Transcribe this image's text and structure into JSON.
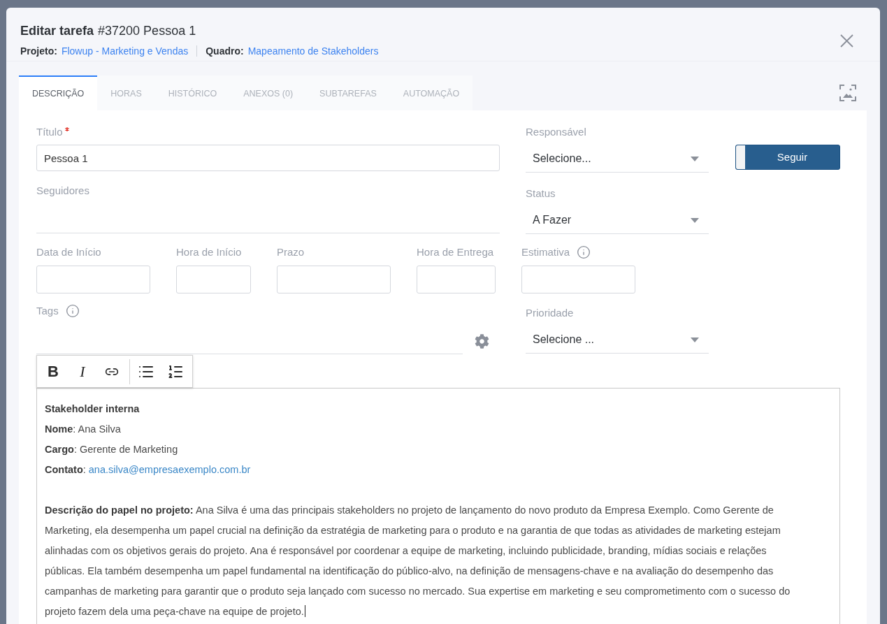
{
  "dialog": {
    "title": "Editar tarefa",
    "task": "#37200 Pessoa 1",
    "project": {
      "label": "Projeto:",
      "link": "Flowup - Marketing e Vendas"
    },
    "board": {
      "label": "Quadro:",
      "link": "Mapeamento de Stakeholders"
    }
  },
  "tabs": [
    {
      "label": "DESCRIÇÃO",
      "selected": true
    },
    {
      "label": "HORAS",
      "selected": false
    },
    {
      "label": "HISTÓRICO",
      "selected": false
    },
    {
      "label": "ANEXOS (0)",
      "selected": false
    },
    {
      "label": "SUBTAREFAS",
      "selected": false
    },
    {
      "label": "AUTOMAÇÃO",
      "selected": false
    }
  ],
  "form": {
    "title_field": {
      "label": "Título",
      "required": true,
      "value": "Pessoa 1"
    },
    "followers": {
      "label": "Seguidores"
    },
    "assignee": {
      "label": "Responsável",
      "value": "Selecione..."
    },
    "follow_button": {
      "label": "Seguir"
    },
    "status": {
      "label": "Status",
      "value": "A Fazer"
    },
    "schedule": [
      {
        "label": "Data de Início"
      },
      {
        "label": "Hora de Início"
      },
      {
        "label": "Prazo"
      },
      {
        "label": "Hora de Entrega"
      },
      {
        "label": "Estimativa",
        "info": true
      }
    ],
    "tags": {
      "label": "Tags",
      "info": true
    },
    "priority": {
      "label": "Prioridade",
      "value": "Selecione ..."
    }
  },
  "editor": {
    "toolbar": [
      {
        "kind": "bold",
        "label": "B"
      },
      {
        "kind": "italic",
        "label": "I"
      },
      {
        "kind": "link"
      },
      {
        "kind": "separator"
      },
      {
        "kind": "bullet_list"
      },
      {
        "kind": "ordered_list"
      }
    ],
    "blocks": [
      {
        "kind": "heading",
        "text": "Stakeholder interna"
      },
      {
        "kind": "text",
        "text": "**Nome**: Ana Silva"
      },
      {
        "kind": "text",
        "text": "**Cargo**: Gerente de Marketing"
      },
      {
        "kind": "contact",
        "text": "**Contato**:",
        "link": "ana.silva@empresaexemplo.com.br"
      },
      {
        "kind": "paragraph",
        "text": "**Descrição do papel no projeto:** Ana Silva é uma das principais stakeholders no projeto de lançamento do novo produto da Empresa Exemplo. Como Gerente de Marketing, ela desempenha um papel crucial na definição da estratégia de marketing para o produto e na garantia de que todas as atividades de marketing estejam alinhadas com os objetivos gerais do projeto. Ana é responsável por coordenar a equipe de marketing, incluindo publicidade, branding, mídias sociais e relações públicas. Ela também desempenha um papel fundamental na identificação do público-alvo, na definição de mensagens-chave e na avaliação do desempenho das campanhas de marketing para garantir que o produto seja lançado com sucesso no mercado. Sua expertise em marketing e seu comprometimento com o sucesso do projeto fazem dela uma peça-chave na equipe de projeto."
      }
    ],
    "cursor": true
  }
}
